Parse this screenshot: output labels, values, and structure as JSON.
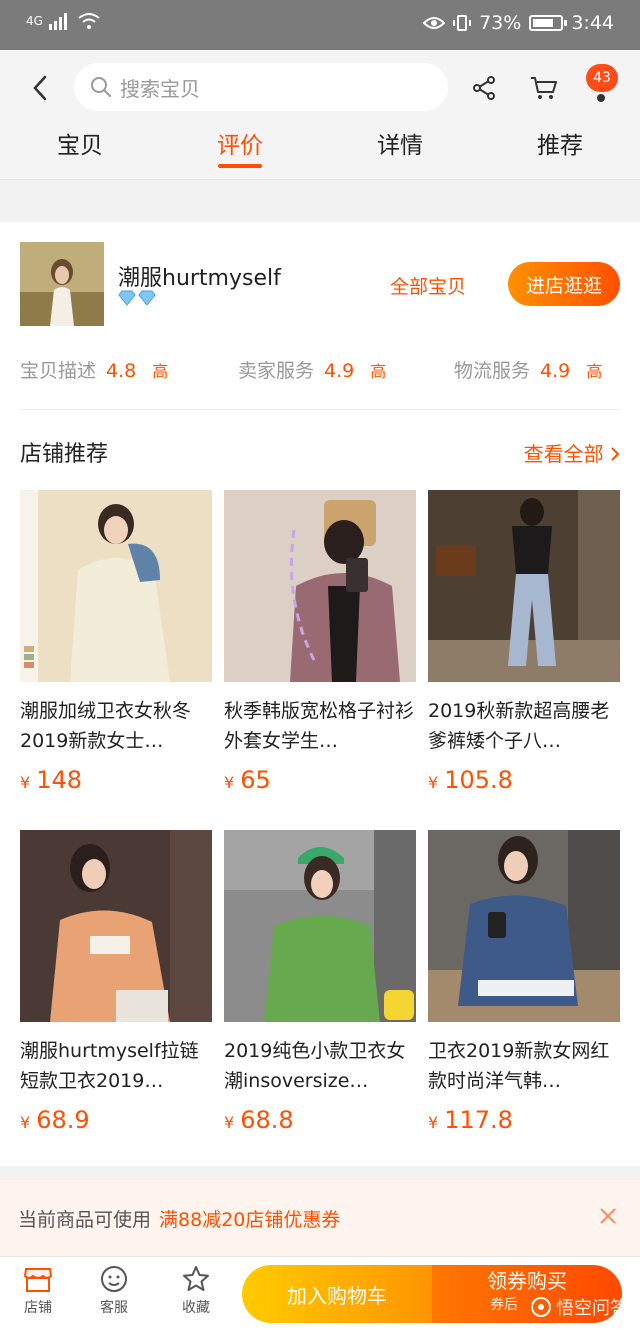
{
  "status_bar": {
    "network": "4G",
    "battery_percent": "73%",
    "time": "3:44"
  },
  "header": {
    "search_placeholder": "搜索宝贝",
    "message_badge": "43",
    "tabs": [
      {
        "label": "宝贝"
      },
      {
        "label": "评价"
      },
      {
        "label": "详情"
      },
      {
        "label": "推荐"
      }
    ],
    "active_tab": "评价"
  },
  "shop": {
    "name": "潮服hurtmyself",
    "all_items_label": "全部宝贝",
    "enter_button": "进店逛逛",
    "ratings": [
      {
        "label": "宝贝描述",
        "score": "4.8",
        "level": "高"
      },
      {
        "label": "卖家服务",
        "score": "4.9",
        "level": "高"
      },
      {
        "label": "物流服务",
        "score": "4.9",
        "level": "高"
      }
    ]
  },
  "recommend": {
    "title": "店铺推荐",
    "view_all": "查看全部",
    "currency": "¥",
    "products": [
      {
        "title": "潮服加绒卫衣女秋冬2019新款女士…",
        "price": "148",
        "bg": "#e9dcc0",
        "accent": "#9aa6b8"
      },
      {
        "title": "秋季韩版宽松格子衬衫外套女学生…",
        "price": "65",
        "bg": "#d9cdc5",
        "accent": "#9b6b6e"
      },
      {
        "title": "2019秋新款超高腰老爹裤矮个子八…",
        "price": "105.8",
        "bg": "#5b4a3a",
        "accent": "#a9b7cc"
      },
      {
        "title": "潮服hurtmyself拉链短款卫衣2019…",
        "price": "68.9",
        "bg": "#4a3a36",
        "accent": "#e89a6a"
      },
      {
        "title": "2019纯色小款卫衣女潮insoversize…",
        "price": "68.8",
        "bg": "#8e8e8e",
        "accent": "#64a64e"
      },
      {
        "title": "卫衣2019新款女网红款时尚洋气韩…",
        "price": "117.8",
        "bg": "#6d6a66",
        "accent": "#3f5a86"
      }
    ]
  },
  "coupon": {
    "label": "当前商品可使用",
    "highlight": "满88减20店铺优惠券"
  },
  "bottom_bar": {
    "shop_label": "店铺",
    "service_label": "客服",
    "favorite_label": "收藏",
    "add_cart": "加入购物车",
    "buy": "领券购买",
    "buy_sub": "券后",
    "watermark": "悟空问答"
  },
  "colors": {
    "accent": "#ff5000",
    "status_bar": "#7b7b7b"
  }
}
